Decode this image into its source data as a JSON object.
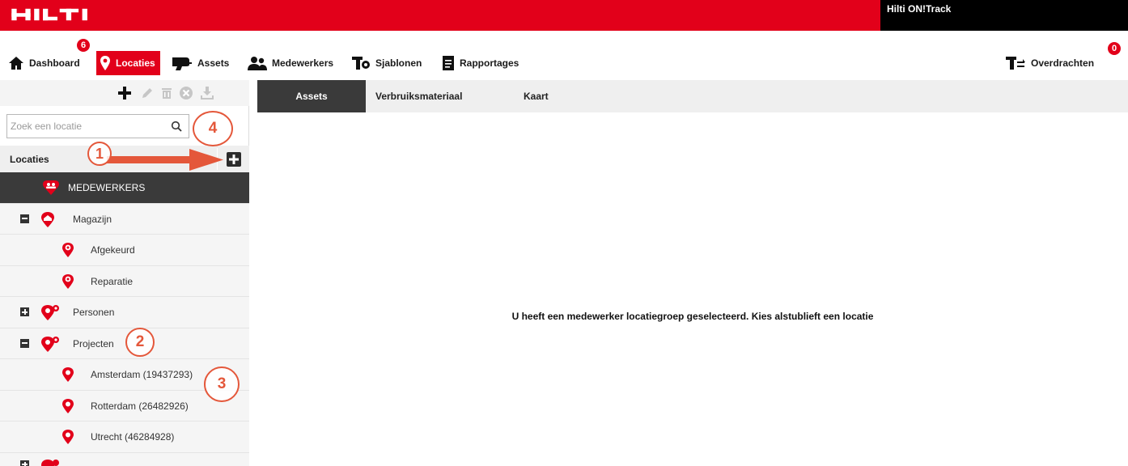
{
  "brand": {
    "logo_text": "HILTI",
    "product": "Hilti ON!Track",
    "color": "#e2001a"
  },
  "nav": {
    "items": [
      {
        "label": "Dashboard",
        "icon": "home-icon",
        "badge": "6"
      },
      {
        "label": "Locaties",
        "icon": "location-pin-icon",
        "active": true
      },
      {
        "label": "Assets",
        "icon": "drill-icon"
      },
      {
        "label": "Medewerkers",
        "icon": "people-icon"
      },
      {
        "label": "Sjablonen",
        "icon": "template-icon"
      },
      {
        "label": "Rapportages",
        "icon": "report-icon"
      }
    ],
    "transfers": {
      "label": "Overdrachten",
      "icon": "transfer-icon",
      "badge": "0"
    }
  },
  "sidebar": {
    "toolbar": [
      "add-icon",
      "edit-icon",
      "delete-icon",
      "remove-icon",
      "download-icon"
    ],
    "search_placeholder": "Zoek een locatie",
    "header": "Locaties",
    "tree": [
      {
        "label": "MEDEWERKERS",
        "level": 0,
        "icon": "people-pin-icon",
        "selected": true
      },
      {
        "label": "Magazijn",
        "level": 0,
        "expander": "collapse",
        "icon": "warehouse-pin-icon"
      },
      {
        "label": "Afgekeurd",
        "level": 1,
        "icon": "location-pin-icon"
      },
      {
        "label": "Reparatie",
        "level": 1,
        "icon": "location-pin-icon"
      },
      {
        "label": "Personen",
        "level": 0,
        "expander": "expand",
        "icon": "group-pin-icon"
      },
      {
        "label": "Projecten",
        "level": 0,
        "expander": "collapse",
        "icon": "group-pin-icon"
      },
      {
        "label": "Amsterdam (19437293)",
        "level": 1,
        "icon": "location-pin-icon"
      },
      {
        "label": "Rotterdam (26482926)",
        "level": 1,
        "icon": "location-pin-icon"
      },
      {
        "label": "Utrecht (46284928)",
        "level": 1,
        "icon": "location-pin-icon"
      }
    ]
  },
  "content": {
    "tabs": [
      "Assets",
      "Verbruiksmateriaal",
      "Kaart"
    ],
    "message": "U heeft een medewerker locatiegroep geselecteerd. Kies alstublieft een locatie"
  },
  "annotations": [
    "1",
    "2",
    "3",
    "4"
  ]
}
